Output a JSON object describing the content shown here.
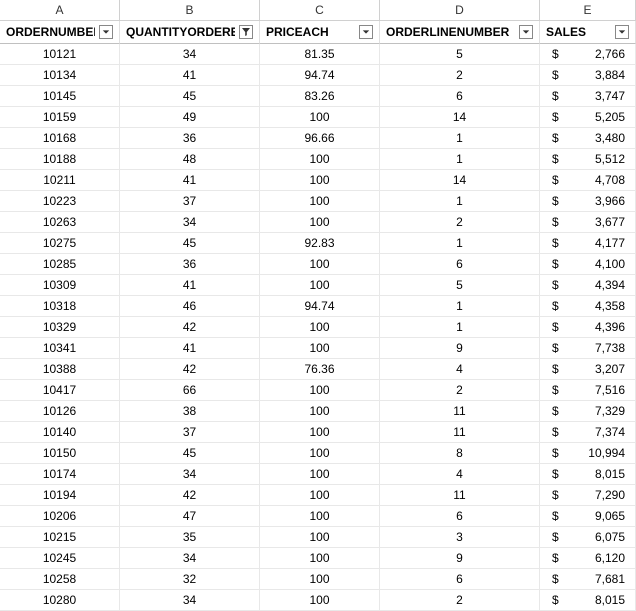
{
  "columns": [
    "A",
    "B",
    "C",
    "D",
    "E"
  ],
  "headers": [
    {
      "label": "ORDERNUMBER",
      "filter": "dropdown"
    },
    {
      "label": "QUANTITYORDERED",
      "filter": "active"
    },
    {
      "label": "PRICEACH",
      "filter": "dropdown"
    },
    {
      "label": "ORDERLINENUMBER",
      "filter": "dropdown"
    },
    {
      "label": "SALES",
      "filter": "dropdown"
    }
  ],
  "currency": "$",
  "chart_data": {
    "type": "table",
    "columns": [
      "ORDERNUMBER",
      "QUANTITYORDERED",
      "PRICEACH",
      "ORDERLINENUMBER",
      "SALES"
    ],
    "rows": [
      [
        10121,
        34,
        81.35,
        5,
        2766
      ],
      [
        10134,
        41,
        94.74,
        2,
        3884
      ],
      [
        10145,
        45,
        83.26,
        6,
        3747
      ],
      [
        10159,
        49,
        100,
        14,
        5205
      ],
      [
        10168,
        36,
        96.66,
        1,
        3480
      ],
      [
        10188,
        48,
        100,
        1,
        5512
      ],
      [
        10211,
        41,
        100,
        14,
        4708
      ],
      [
        10223,
        37,
        100,
        1,
        3966
      ],
      [
        10263,
        34,
        100,
        2,
        3677
      ],
      [
        10275,
        45,
        92.83,
        1,
        4177
      ],
      [
        10285,
        36,
        100,
        6,
        4100
      ],
      [
        10309,
        41,
        100,
        5,
        4394
      ],
      [
        10318,
        46,
        94.74,
        1,
        4358
      ],
      [
        10329,
        42,
        100,
        1,
        4396
      ],
      [
        10341,
        41,
        100,
        9,
        7738
      ],
      [
        10388,
        42,
        76.36,
        4,
        3207
      ],
      [
        10417,
        66,
        100,
        2,
        7516
      ],
      [
        10126,
        38,
        100,
        11,
        7329
      ],
      [
        10140,
        37,
        100,
        11,
        7374
      ],
      [
        10150,
        45,
        100,
        8,
        10994
      ],
      [
        10174,
        34,
        100,
        4,
        8015
      ],
      [
        10194,
        42,
        100,
        11,
        7290
      ],
      [
        10206,
        47,
        100,
        6,
        9065
      ],
      [
        10215,
        35,
        100,
        3,
        6075
      ],
      [
        10245,
        34,
        100,
        9,
        6120
      ],
      [
        10258,
        32,
        100,
        6,
        7681
      ],
      [
        10280,
        34,
        100,
        2,
        8015
      ]
    ]
  }
}
